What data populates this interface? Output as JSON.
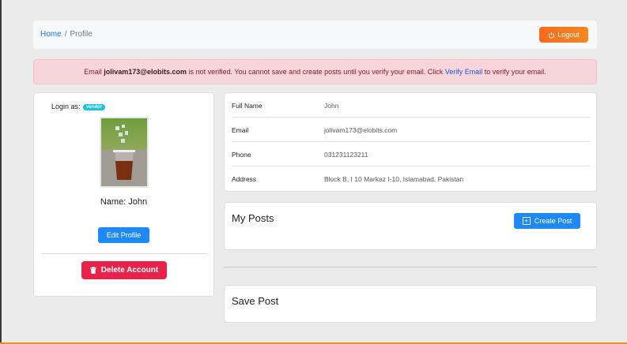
{
  "breadcrumb": {
    "home": "Home",
    "separator": "/",
    "current": "Profile"
  },
  "header": {
    "logout_label": "Logout",
    "logout_icon": "power-icon",
    "logout_color": "#f66a1d"
  },
  "alert": {
    "prefix": "Email",
    "email": "jolivam173@elobits.com",
    "message": "is not verified. You cannot save and create posts until you verify your email. Click",
    "link_label": "Verify Email",
    "suffix": "to verify your email.",
    "background_color": "#f7d5da"
  },
  "profile": {
    "login_as_label": "Login as:",
    "role": "vendor",
    "avatar_alt": "iced drink photo",
    "name_line": "Name: John",
    "edit_label": "Edit Profile",
    "delete_label": "Delete Account",
    "delete_icon": "trash-icon"
  },
  "details": [
    {
      "label": "Full Name",
      "value": "John"
    },
    {
      "label": "Email",
      "value": "jolivam173@elobits.com"
    },
    {
      "label": "Phone",
      "value": "031231123211"
    },
    {
      "label": "Address",
      "value": "Block B, I 10 Markaz I-10, Islamabad, Pakistan"
    }
  ],
  "posts": {
    "title": "My Posts",
    "create_label": "Create Post",
    "create_icon": "plus-square-icon"
  },
  "save_post": {
    "title": "Save Post"
  },
  "colors": {
    "primary": "#1e88f5",
    "danger": "#e8224a",
    "badge": "#1ac2de"
  }
}
